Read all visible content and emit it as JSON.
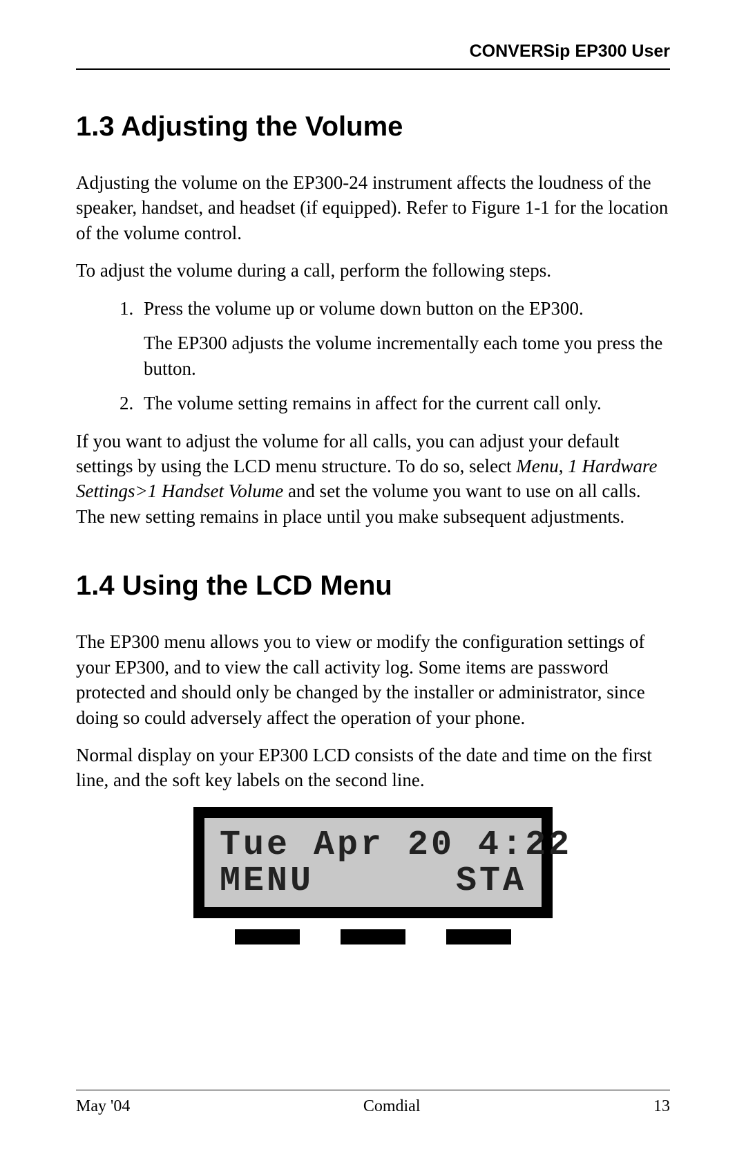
{
  "header": {
    "running_title": "CONVERSip EP300 User"
  },
  "section13": {
    "heading": "1.3  Adjusting the Volume",
    "p1": "Adjusting the volume on the EP300-24 instrument affects the loudness of the speaker, handset, and headset (if equipped).  Refer to Figure 1-1 for the location of the volume control.",
    "p2": "To adjust the volume during a call, perform the following steps.",
    "steps": {
      "s1a": "Press the volume up or volume down button on the EP300.",
      "s1b": "The EP300 adjusts the volume incrementally each tome you press the button.",
      "s2": "The volume setting remains in affect for the current call only."
    },
    "p3a": "If you want to adjust the volume for all calls, you can adjust your default settings by using the LCD menu structure.  To do so, select ",
    "p3_italic": "Menu, 1 Hardware Settings>1 Handset Volume",
    "p3b": " and set the volume you want to use on all calls.  The new setting remains in place until you make subsequent adjustments."
  },
  "section14": {
    "heading": "1.4  Using the LCD Menu",
    "p1": "The EP300 menu allows you to view or modify the configuration settings of your EP300, and to view the call activity log.  Some items are password protected and should only be changed by the installer or administrator, since doing so could adversely affect the operation of your phone.",
    "p2": "Normal display on your EP300 LCD consists of the date and time on the first line, and the soft key labels on the second line."
  },
  "lcd": {
    "line1": "Tue Apr 20 4:22",
    "line2_left": "MENU",
    "line2_right": "STA"
  },
  "footer": {
    "left": "May '04",
    "center": "Comdial",
    "right": "13"
  }
}
